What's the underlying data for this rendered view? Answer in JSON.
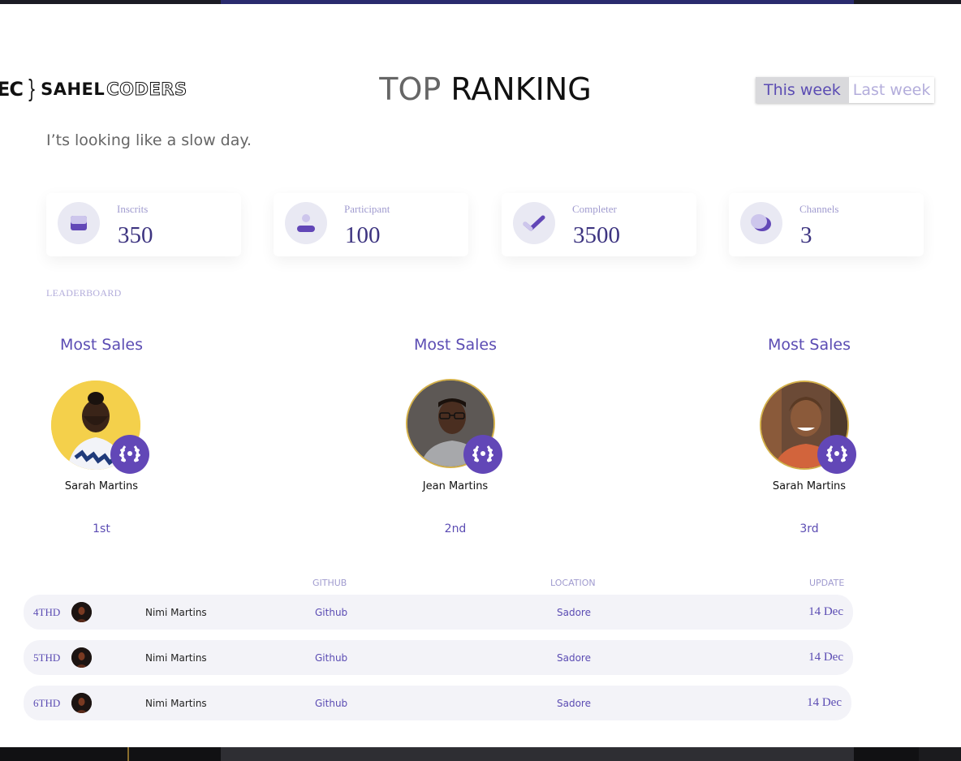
{
  "header": {
    "logo_mark": "EC",
    "logo_brace": "}",
    "logo_word_bold": "SAHEL",
    "logo_word_outline": "CODERS",
    "title_part1": "TOP",
    "title_part2": "RANKING",
    "week_tabs": [
      {
        "label": "This week",
        "active": true
      },
      {
        "label": "Last week",
        "active": false
      }
    ],
    "subtitle": "I’ts looking like a slow day."
  },
  "stats": [
    {
      "label": "Inscrits",
      "value": "350",
      "icon": "inbox-icon"
    },
    {
      "label": "Participant",
      "value": "100",
      "icon": "user-icon"
    },
    {
      "label": "Completer",
      "value": "3500",
      "icon": "checkmark-icon"
    },
    {
      "label": "Channels",
      "value": "3",
      "icon": "chat-bubbles-icon"
    }
  ],
  "leaderboard": {
    "label": "LEADERBOARD",
    "winners": [
      {
        "category": "Most Sales",
        "name": "Sarah Martins",
        "rank": "1st",
        "badge_icon": "laurel-icon"
      },
      {
        "category": "Most Sales",
        "name": "Jean Martins",
        "rank": "2nd",
        "badge_icon": "laurel-icon"
      },
      {
        "category": "Most Sales",
        "name": "Sarah Martins",
        "rank": "3rd",
        "badge_icon": "laurel-icon"
      }
    ],
    "table": {
      "headers": {
        "github": "GITHUB",
        "location": "LOCATION",
        "update": "UPDATE"
      },
      "rows": [
        {
          "position": "4THD",
          "name": "Nimi Martins",
          "github": "Github",
          "location": "Sadore",
          "update": "14 Dec"
        },
        {
          "position": "5THD",
          "name": "Nimi Martins",
          "github": "Github",
          "location": "Sadore",
          "update": "14 Dec"
        },
        {
          "position": "6THD",
          "name": "Nimi Martins",
          "github": "Github",
          "location": "Sadore",
          "update": "14 Dec"
        }
      ]
    }
  },
  "colors": {
    "accent": "#5b4cb3",
    "badge": "#6247b7",
    "muted_accent": "#a09bcf",
    "card_icon_bg": "#e9e9f3",
    "row_bg": "#f3f3f8"
  }
}
